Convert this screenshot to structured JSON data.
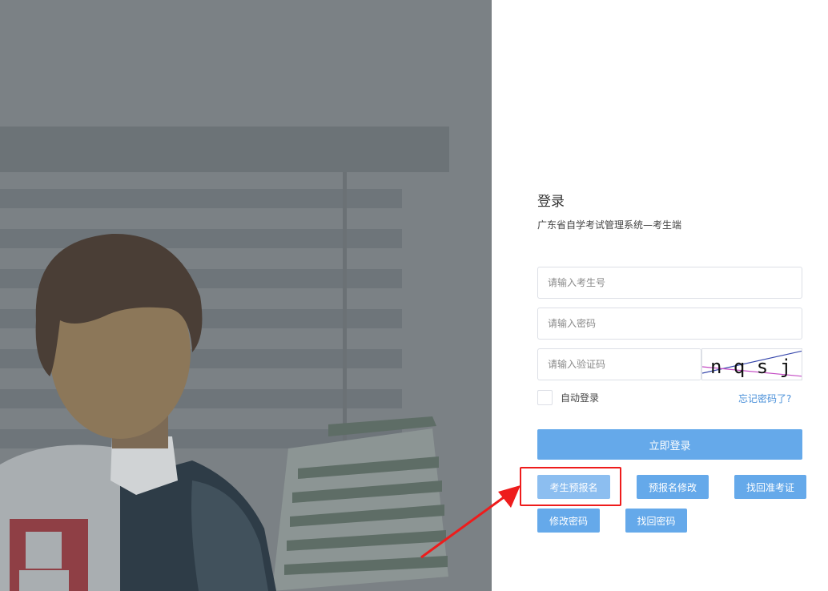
{
  "login": {
    "title": "登录",
    "subtitle": "广东省自学考试管理系统—考生端",
    "username_placeholder": "请输入考生号",
    "password_placeholder": "请输入密码",
    "captcha_placeholder": "请输入验证码",
    "captcha_text": "n q s j",
    "remember_label": "自动登录",
    "forgot_link": "忘记密码了?",
    "submit_label": "立即登录"
  },
  "actions": {
    "pre_register": "考生预报名",
    "modify_registration": "预报名修改",
    "retrieve_ticket": "找回准考证",
    "change_password": "修改密码",
    "retrieve_password": "找回密码"
  },
  "colors": {
    "primary": "#65a9ea",
    "primary_light": "#8cbef0",
    "link": "#4a90d9",
    "highlight": "#ee1c1c",
    "left_bg": "#7b8185"
  }
}
